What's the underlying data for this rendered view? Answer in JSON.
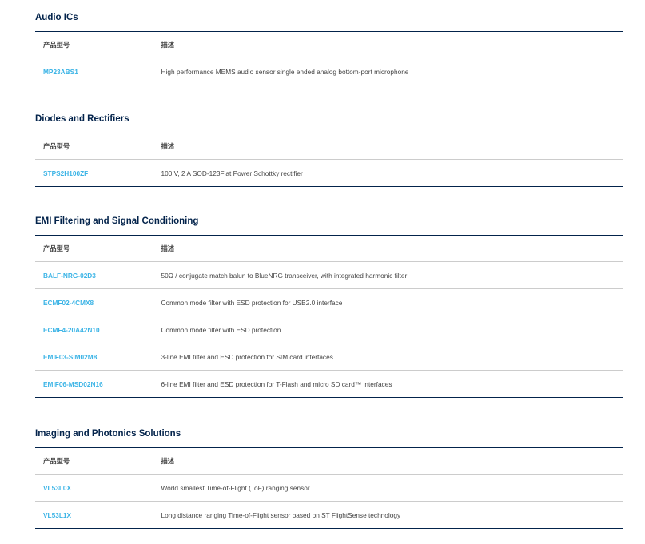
{
  "sections": [
    {
      "title": "Audio ICs",
      "col_part": "产品型号",
      "col_desc": "描述",
      "rows": [
        {
          "part": "MP23ABS1",
          "desc": "High performance MEMS audio sensor single ended analog bottom-port microphone"
        }
      ]
    },
    {
      "title": "Diodes and Rectifiers",
      "col_part": "产品型号",
      "col_desc": "描述",
      "rows": [
        {
          "part": "STPS2H100ZF",
          "desc": "100 V, 2 A SOD-123Flat Power Schottky rectifier"
        }
      ]
    },
    {
      "title": "EMI Filtering and Signal Conditioning",
      "col_part": "产品型号",
      "col_desc": "描述",
      "rows": [
        {
          "part": "BALF-NRG-02D3",
          "desc": "50Ω / conjugate match balun to BlueNRG transceiver, with integrated harmonic filter"
        },
        {
          "part": "ECMF02-4CMX8",
          "desc": "Common mode filter with ESD protection for USB2.0 interface"
        },
        {
          "part": "ECMF4-20A42N10",
          "desc": "Common mode filter with ESD protection"
        },
        {
          "part": "EMIF03-SIM02M8",
          "desc": "3-line EMI filter and ESD protection for SIM card interfaces"
        },
        {
          "part": "EMIF06-MSD02N16",
          "desc": "6-line EMI filter and ESD protection for T-Flash and micro SD card™ interfaces"
        }
      ]
    },
    {
      "title": "Imaging and Photonics Solutions",
      "col_part": "产品型号",
      "col_desc": "描述",
      "rows": [
        {
          "part": "VL53L0X",
          "desc": "World smallest Time-of-Flight (ToF) ranging sensor"
        },
        {
          "part": "VL53L1X",
          "desc": "Long distance ranging Time-of-Flight sensor based on ST FlightSense technology"
        }
      ]
    }
  ],
  "colors": {
    "heading": "#03234b",
    "link": "#3cb4e6",
    "rule_dark": "#03234b",
    "rule_light": "#cccccc"
  }
}
